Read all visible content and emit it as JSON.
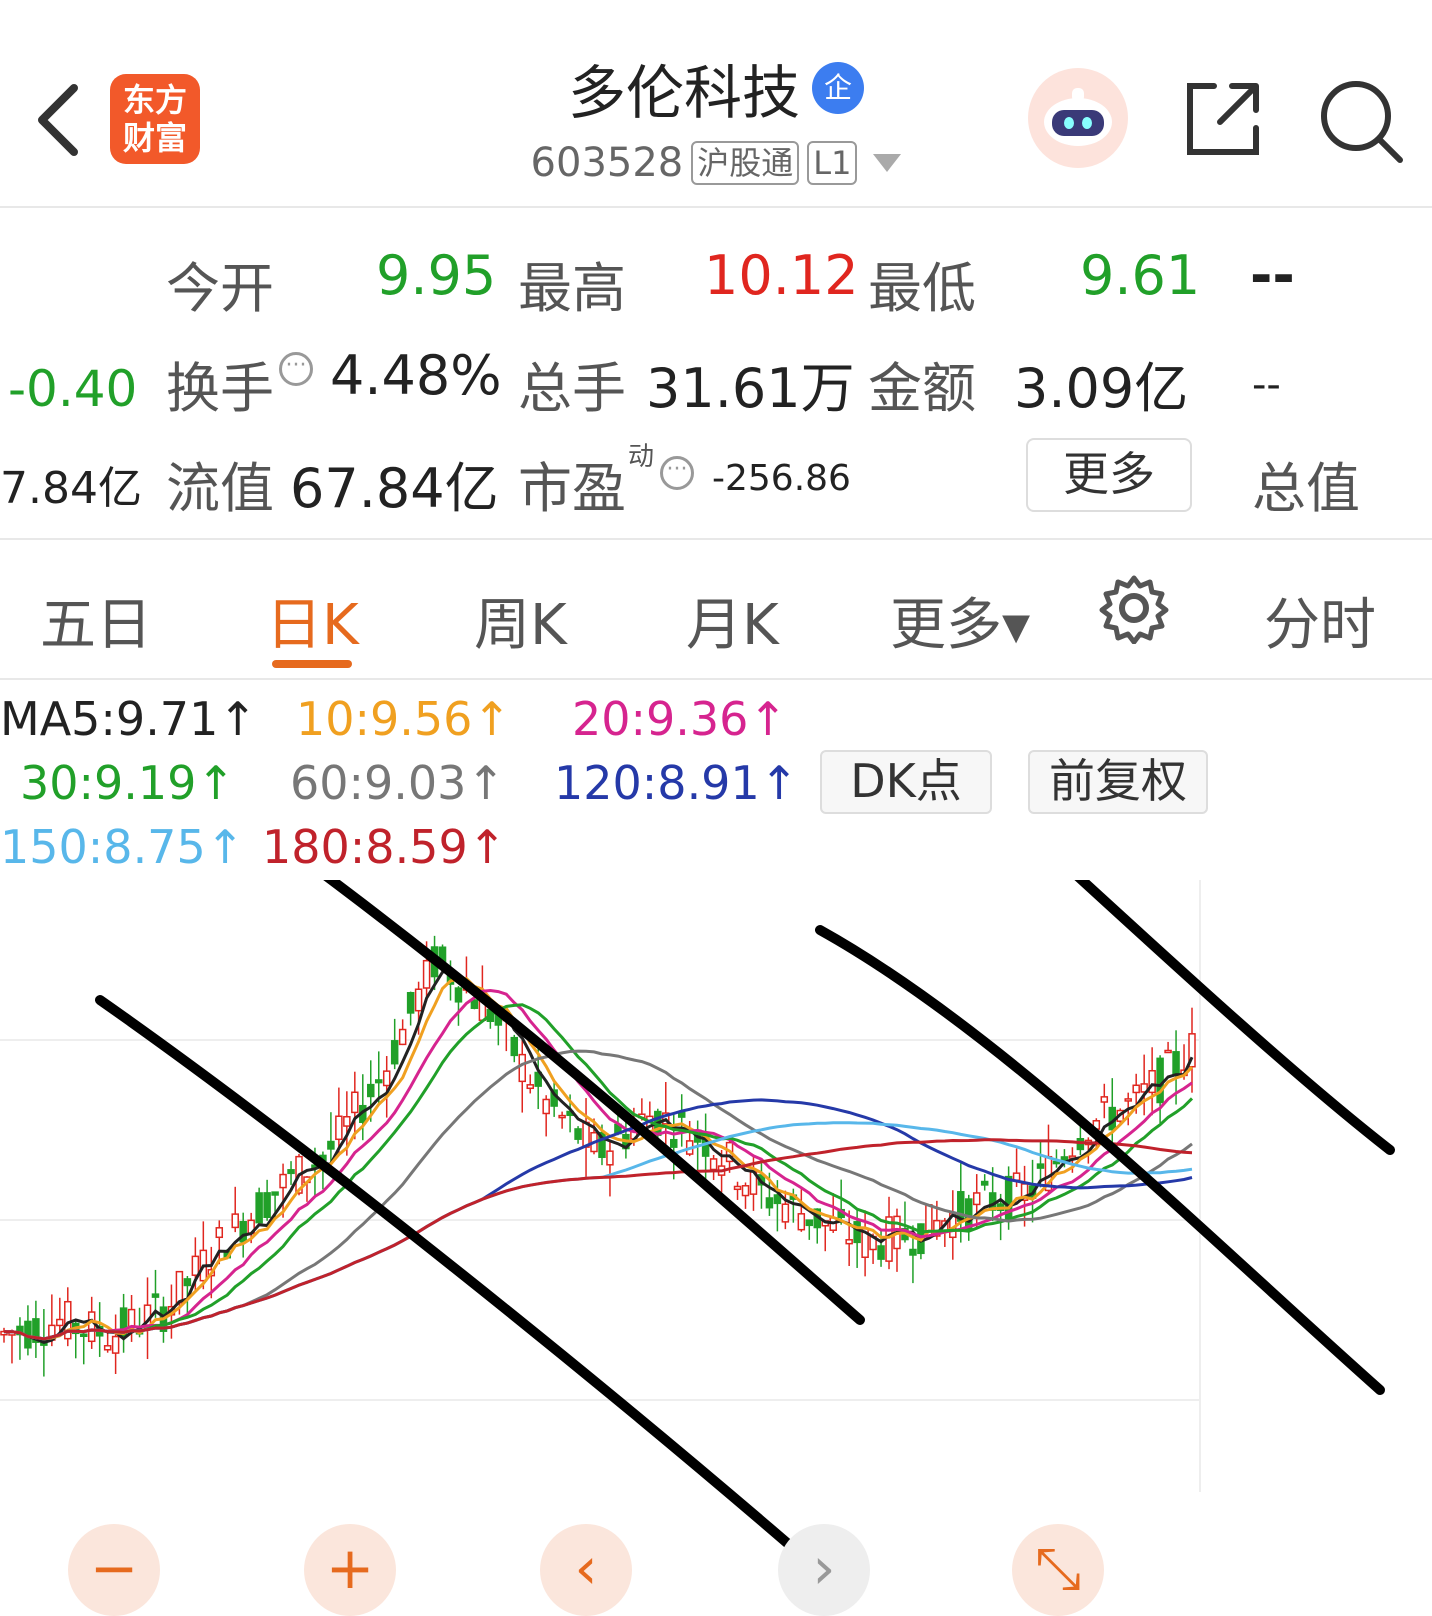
{
  "header": {
    "logo_line1": "东方",
    "logo_line2": "财富",
    "stock_name": "多伦科技",
    "badge": "企",
    "stock_code": "603528",
    "tag_connect": "沪股通",
    "tag_level": "L1"
  },
  "quote": {
    "open_label": "今开",
    "open_value": "9.95",
    "high_label": "最高",
    "high_value": "10.12",
    "low_label": "最低",
    "low_value": "9.61",
    "right_top": "--",
    "change_value": "-0.40",
    "turnover_label": "换手",
    "turnover_value": "4.48%",
    "volume_label": "总手",
    "volume_value": "31.61万",
    "amount_label": "金额",
    "amount_value": "3.09亿",
    "right_mid": "--",
    "left_cap": "7.84亿",
    "float_cap_label": "流值",
    "float_cap_value": "67.84亿",
    "pe_label": "市盈",
    "pe_sup": "动",
    "pe_value": "-256.86",
    "more_button": "更多",
    "total_cap_label": "总值",
    "colors": {
      "up": "#e0261f",
      "down": "#21a029"
    }
  },
  "tabs": [
    {
      "label": "五日"
    },
    {
      "label": "日K",
      "active": true
    },
    {
      "label": "周K"
    },
    {
      "label": "月K"
    },
    {
      "label": "更多▾"
    },
    {
      "label": "分时"
    }
  ],
  "ma_legend": [
    {
      "text": "MA5:9.71↑",
      "color": "#222222"
    },
    {
      "text": "10:9.56↑",
      "color": "#f0a020"
    },
    {
      "text": "20:9.36↑",
      "color": "#d6248f"
    },
    {
      "text": "30:9.19↑",
      "color": "#21a029"
    },
    {
      "text": "60:9.03↑",
      "color": "#777777"
    },
    {
      "text": "120:8.91↑",
      "color": "#2539a8"
    },
    {
      "text": "150:8.75↑",
      "color": "#58b7ea"
    },
    {
      "text": "180:8.59↑",
      "color": "#c0222b"
    }
  ],
  "chart_buttons": {
    "dk": "DK点",
    "adjust": "前复权"
  },
  "controls": [
    "−",
    "+",
    "‹",
    "›",
    "⤡"
  ],
  "chart_data": {
    "type": "candlestick",
    "title": "",
    "ma_lines": [
      "MA5",
      "10",
      "20",
      "30",
      "60",
      "120",
      "150",
      "180"
    ],
    "trend": [
      7.6,
      7.7,
      7.6,
      7.8,
      8.3,
      8.7,
      9.0,
      9.6,
      10.5,
      10.1,
      9.4,
      9.0,
      9.3,
      9.1,
      8.7,
      8.5,
      8.3,
      8.4,
      8.6,
      8.7,
      9.2,
      9.4,
      9.8
    ]
  }
}
